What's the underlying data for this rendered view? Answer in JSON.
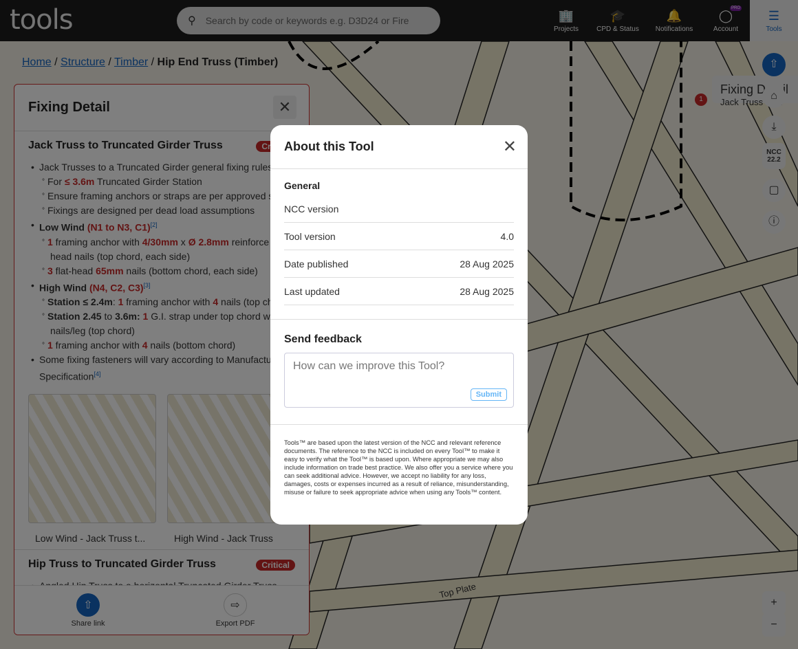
{
  "header": {
    "logo": "tools",
    "search_placeholder": "Search by code or keywords e.g. D3D24 or Fire",
    "nav": [
      {
        "label": "Projects",
        "icon": "building-icon"
      },
      {
        "label": "CPD & Status",
        "icon": "graduation-cap-icon"
      },
      {
        "label": "Notifications",
        "icon": "bell-icon"
      },
      {
        "label": "Account",
        "icon": "account-icon",
        "badge": "PRO"
      },
      {
        "label": "Tools",
        "icon": "menu-icon"
      }
    ]
  },
  "breadcrumb": {
    "items": [
      "Home",
      "Structure",
      "Timber"
    ],
    "current": "Hip End Truss (Timber)"
  },
  "panel": {
    "title": "Fixing Detail",
    "section1": {
      "title": "Jack Truss to Truncated Girder Truss",
      "badge": "Critical",
      "b1": "Jack Trusses to a Truncated Girder general fixing rules",
      "b1a_pre": "For ",
      "b1a_r": "≤ 3.6m",
      "b1a_post": " Truncated Girder Station",
      "b1b": "Ensure framing anchors or straps are per approved s",
      "b1c": "Fixings are designed per dead load assumptions",
      "b2": "Low Wind",
      "b2r": "(N1 to N3, C1)",
      "b2ref": "[2]",
      "b2a_n": "1",
      "b2a_t": " framing anchor with ",
      "b2a_r1": "4/30mm",
      "b2a_x": " x ",
      "b2a_r2": "Ø 2.8mm",
      "b2a_post": " reinforce",
      "b2a_cont": "head nails (top chord, each side)",
      "b2b_n": "3",
      "b2b_t": " flat-head ",
      "b2b_r": "65mm",
      "b2b_post": " nails (bottom chord, each side)",
      "b3": "High Wind",
      "b3r": "(N4, C2, C3)",
      "b3ref": "[3]",
      "b3a_b": "Station ≤ 2.4m",
      "b3a_c": ": ",
      "b3a_n": "1",
      "b3a_t": " framing anchor with ",
      "b3a_n2": "4",
      "b3a_post": " nails (top ch",
      "b3b_b": "Station 2.45",
      "b3b_to": " to ",
      "b3b_b2": "3.6m:",
      "b3b_n": " 1",
      "b3b_post": " G.I. strap under top chord wi",
      "b3b_cont": "nails/leg (top chord)",
      "b3c_n": "1",
      "b3c_t": " framing anchor with ",
      "b3c_n2": "4",
      "b3c_post": " nails (bottom chord)",
      "b4": "Some fixing fasteners will vary according to Manufactu",
      "b4_cont": "Specification",
      "b4ref": "[4]",
      "images": [
        {
          "caption": "Low Wind - Jack Truss t..."
        },
        {
          "caption": "High Wind - Jack Truss"
        }
      ]
    },
    "section2": {
      "title": "Hip Truss to Truncated Girder Truss",
      "badge": "Critical",
      "b1": "Angled Hip Truss to a horizontal Truncated Girder Truss"
    },
    "footer": {
      "share": "Share link",
      "export": "Export PDF"
    }
  },
  "right": {
    "tooltip_title": "Fixing Detail",
    "tooltip_item": "Jack Truss to Tr",
    "ncc_label": "NCC",
    "ncc_version": "22.2",
    "marker": "1"
  },
  "map": {
    "label": "Top Plate"
  },
  "modal": {
    "title": "About this Tool",
    "general": "General",
    "rows": [
      {
        "label": "NCC version",
        "value": ""
      },
      {
        "label": "Tool version",
        "value": "4.0"
      },
      {
        "label": "Date published",
        "value": "28 Aug 2025"
      },
      {
        "label": "Last updated",
        "value": "28 Aug 2025"
      }
    ],
    "feedback_title": "Send feedback",
    "feedback_placeholder": "How can we improve this Tool?",
    "submit": "Submit",
    "disclaimer": "Tools™ are based upon the latest version of the NCC and relevant reference documents. The reference to the NCC is included on every Tool™ to make it easy to verify what the Tool™ is based upon. Where appropriate we may also include information on trade best practice. We also offer you a service where you can seek additional advice. However, we accept no liability for any loss, damages, costs or expenses incurred as a result of reliance, misunderstanding, misuse or failure to seek appropriate advice when using any Tools™ content."
  },
  "colors": {
    "accent": "#1565c0",
    "critical": "#c62828",
    "header": "#1c1c1c"
  }
}
